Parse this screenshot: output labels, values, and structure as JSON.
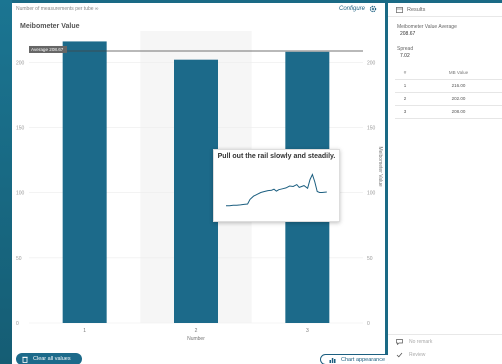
{
  "topbar": {
    "settings_label": "Number of measurements per tube ∞",
    "configure_label": "Configure"
  },
  "chart_data": {
    "type": "bar",
    "title": "Meibometer Value",
    "categories": [
      "1",
      "2",
      "3"
    ],
    "values": [
      216,
      202,
      208
    ],
    "xlabel": "Number",
    "ylabel": "Meibometer Value",
    "ylim": [
      0,
      224
    ],
    "yticks": [
      0,
      50,
      100,
      150,
      200
    ],
    "average_value": 208.67,
    "average_label": "Average 208.67",
    "bar_color": "#1c6a8a",
    "grid": true
  },
  "popup": {
    "title": "Pull out the rail slowly and steadily.",
    "trace": [
      [
        0,
        2
      ],
      [
        3,
        2
      ],
      [
        6,
        2.1
      ],
      [
        9,
        2.1
      ],
      [
        12,
        2.2
      ],
      [
        15,
        2.3
      ],
      [
        18,
        2.4
      ],
      [
        20,
        3.4
      ],
      [
        23,
        4.1
      ],
      [
        26,
        4.5
      ],
      [
        29,
        4.9
      ],
      [
        32,
        5.1
      ],
      [
        35,
        5.3
      ],
      [
        38,
        5.4
      ],
      [
        40,
        5.6
      ],
      [
        42,
        5.2
      ],
      [
        44,
        5.5
      ],
      [
        47,
        5.7
      ],
      [
        50,
        5.9
      ],
      [
        53,
        6.3
      ],
      [
        56,
        6.2
      ],
      [
        59,
        6.6
      ],
      [
        61,
        6.0
      ],
      [
        63,
        6.2
      ],
      [
        65,
        6.4
      ],
      [
        68,
        5.8
      ],
      [
        70,
        7.7
      ],
      [
        72,
        8.8
      ],
      [
        74,
        7.2
      ],
      [
        76,
        5.1
      ],
      [
        78,
        4.9
      ],
      [
        80,
        4.9
      ],
      [
        84,
        5.0
      ]
    ],
    "trace_color": "#1c5f80"
  },
  "buttons": {
    "clear_all": "Clear all values",
    "chart_appearance": "Chart appearance"
  },
  "results": {
    "header": "Results",
    "average_label": "Meibometer Value Average",
    "average_value": "208.67",
    "spread_label": "Spread",
    "spread_value": "7.02",
    "columns": [
      "#",
      "MB Value"
    ],
    "rows": [
      [
        "1",
        "216.00"
      ],
      [
        "2",
        "202.00"
      ],
      [
        "3",
        "208.00"
      ]
    ],
    "remark_label": "No remark",
    "review_label": "Review"
  },
  "colors": {
    "accent": "#1c6a8a",
    "background": "#1a6a85"
  }
}
